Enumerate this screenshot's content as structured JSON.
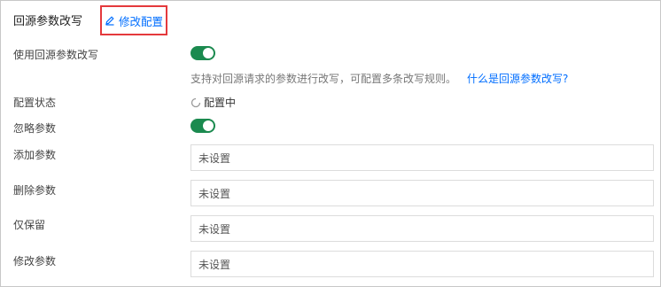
{
  "section": {
    "title": "回源参数改写",
    "edit_label": "修改配置"
  },
  "rows": {
    "rewrite": {
      "label": "使用回源参数改写",
      "enabled": true
    },
    "description": "支持对回源请求的参数进行改写，可配置多条改写规则。",
    "help_link": "什么是回源参数改写?",
    "status": {
      "label": "配置状态",
      "value": "配置中"
    },
    "ignore": {
      "label": "忽略参数",
      "enabled": true
    },
    "add": {
      "label": "添加参数",
      "value": "未设置"
    },
    "delete": {
      "label": "删除参数",
      "value": "未设置"
    },
    "keep": {
      "label": "仅保留",
      "value": "未设置"
    },
    "modify": {
      "label": "修改参数",
      "value": "未设置"
    }
  },
  "colors": {
    "accent": "#006eff",
    "toggle_on": "#1b8a4f",
    "highlight_border": "#e4393c"
  },
  "icons": {
    "edit": "pencil-icon",
    "status": "spinner-icon"
  }
}
